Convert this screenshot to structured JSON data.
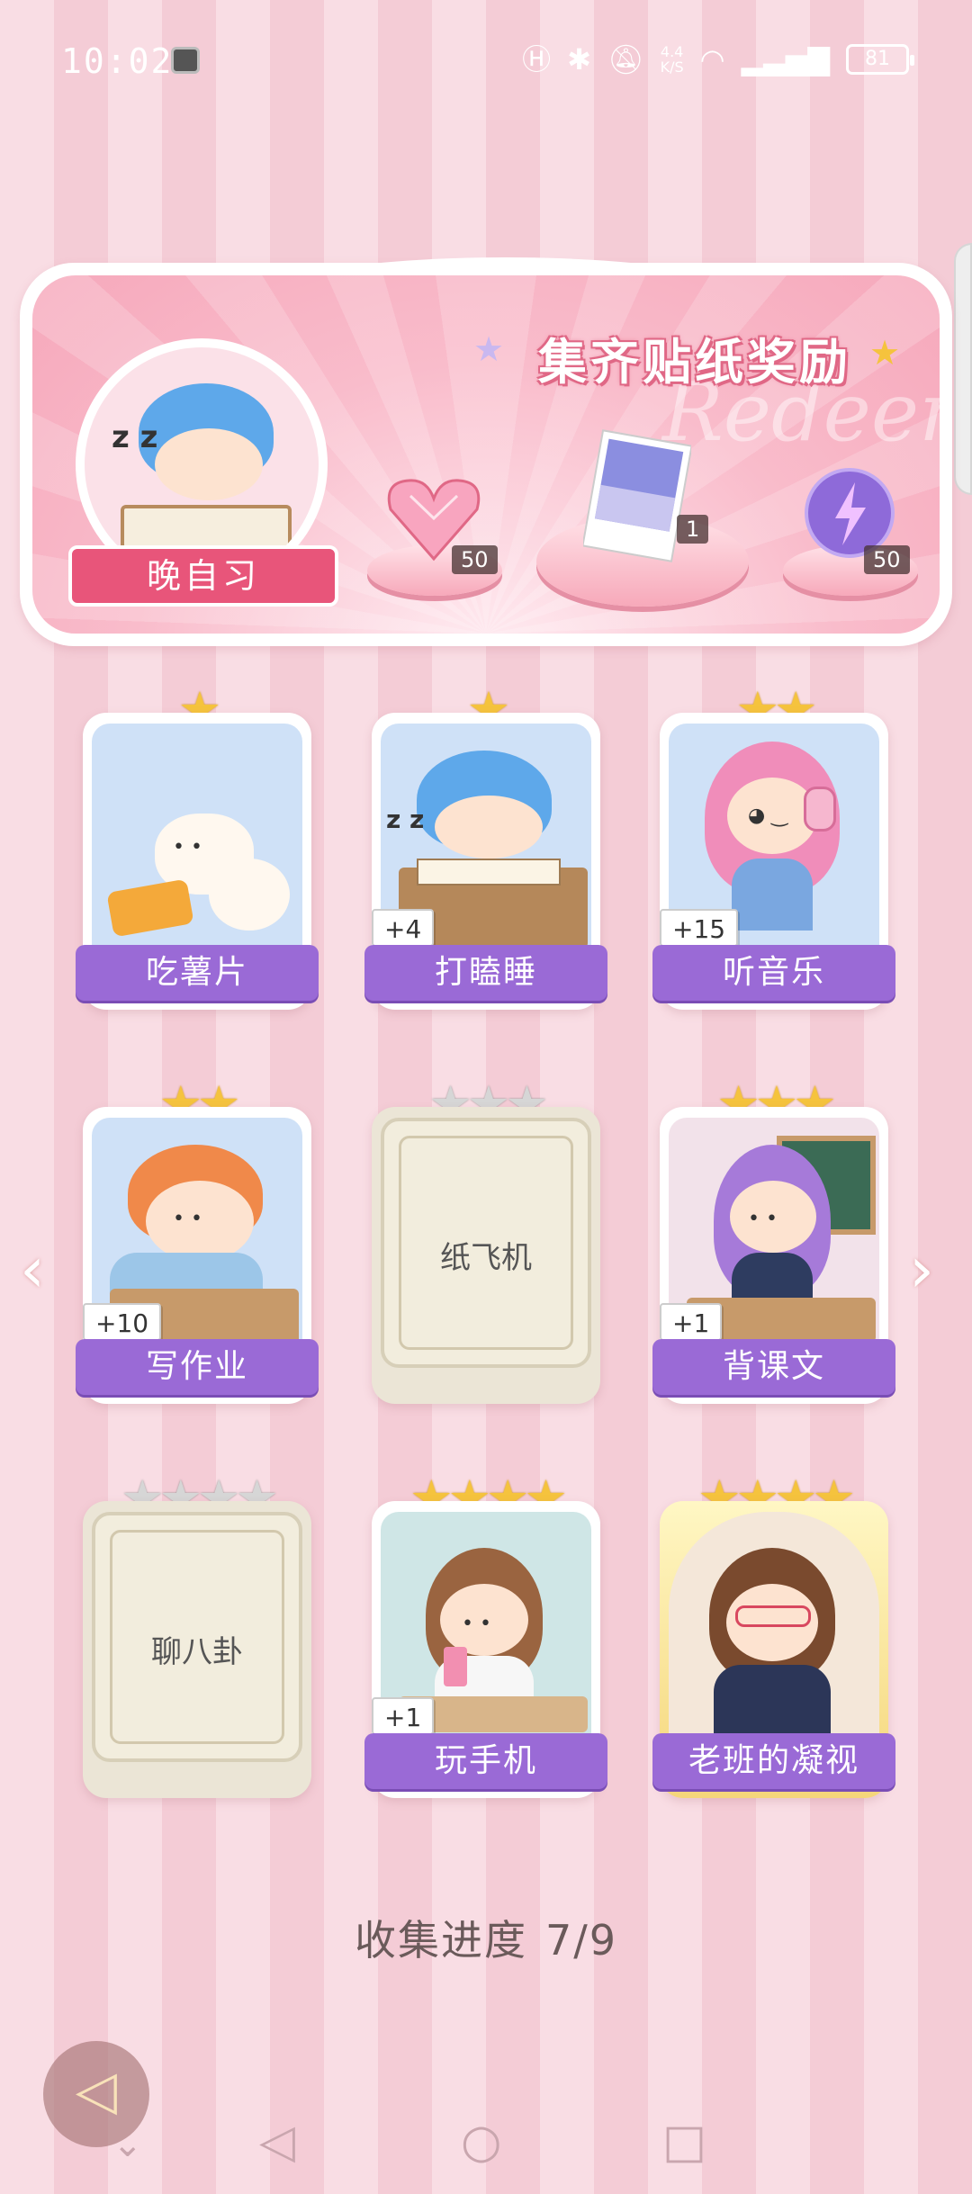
{
  "status_bar": {
    "time": "10:02",
    "net_rate_top": "4.4",
    "net_rate_bottom": "K/S",
    "battery": "81"
  },
  "banner": {
    "title": "集齐贴纸奖励",
    "watermark": "Redeem",
    "current_sticker": "晚自习",
    "rewards": [
      {
        "icon": "pink-heart-gem-icon",
        "count": "50"
      },
      {
        "icon": "photo-card-icon",
        "count": "1"
      },
      {
        "icon": "purple-energy-orb-icon",
        "count": "50"
      }
    ]
  },
  "stickers": [
    {
      "name": "吃薯片",
      "stars": 1,
      "max_stars": 1,
      "collected": true,
      "bonus": ""
    },
    {
      "name": "打瞌睡",
      "stars": 1,
      "max_stars": 1,
      "collected": true,
      "bonus": "+4"
    },
    {
      "name": "听音乐",
      "stars": 2,
      "max_stars": 2,
      "collected": true,
      "bonus": "+15"
    },
    {
      "name": "写作业",
      "stars": 2,
      "max_stars": 2,
      "collected": true,
      "bonus": "+10"
    },
    {
      "name": "纸飞机",
      "stars": 0,
      "max_stars": 3,
      "collected": false,
      "bonus": ""
    },
    {
      "name": "背课文",
      "stars": 3,
      "max_stars": 3,
      "collected": true,
      "bonus": "+1"
    },
    {
      "name": "聊八卦",
      "stars": 0,
      "max_stars": 4,
      "collected": false,
      "bonus": ""
    },
    {
      "name": "玩手机",
      "stars": 4,
      "max_stars": 4,
      "collected": true,
      "bonus": "+1"
    },
    {
      "name": "老班的凝视",
      "stars": 4,
      "max_stars": 4,
      "collected": true,
      "bonus": ""
    }
  ],
  "progress": {
    "label": "收集进度",
    "value": "7/9"
  },
  "colors": {
    "accent_purple": "#9a6ad6",
    "banner_pink": "#f9bccb",
    "star_gold": "#f5c33d"
  }
}
